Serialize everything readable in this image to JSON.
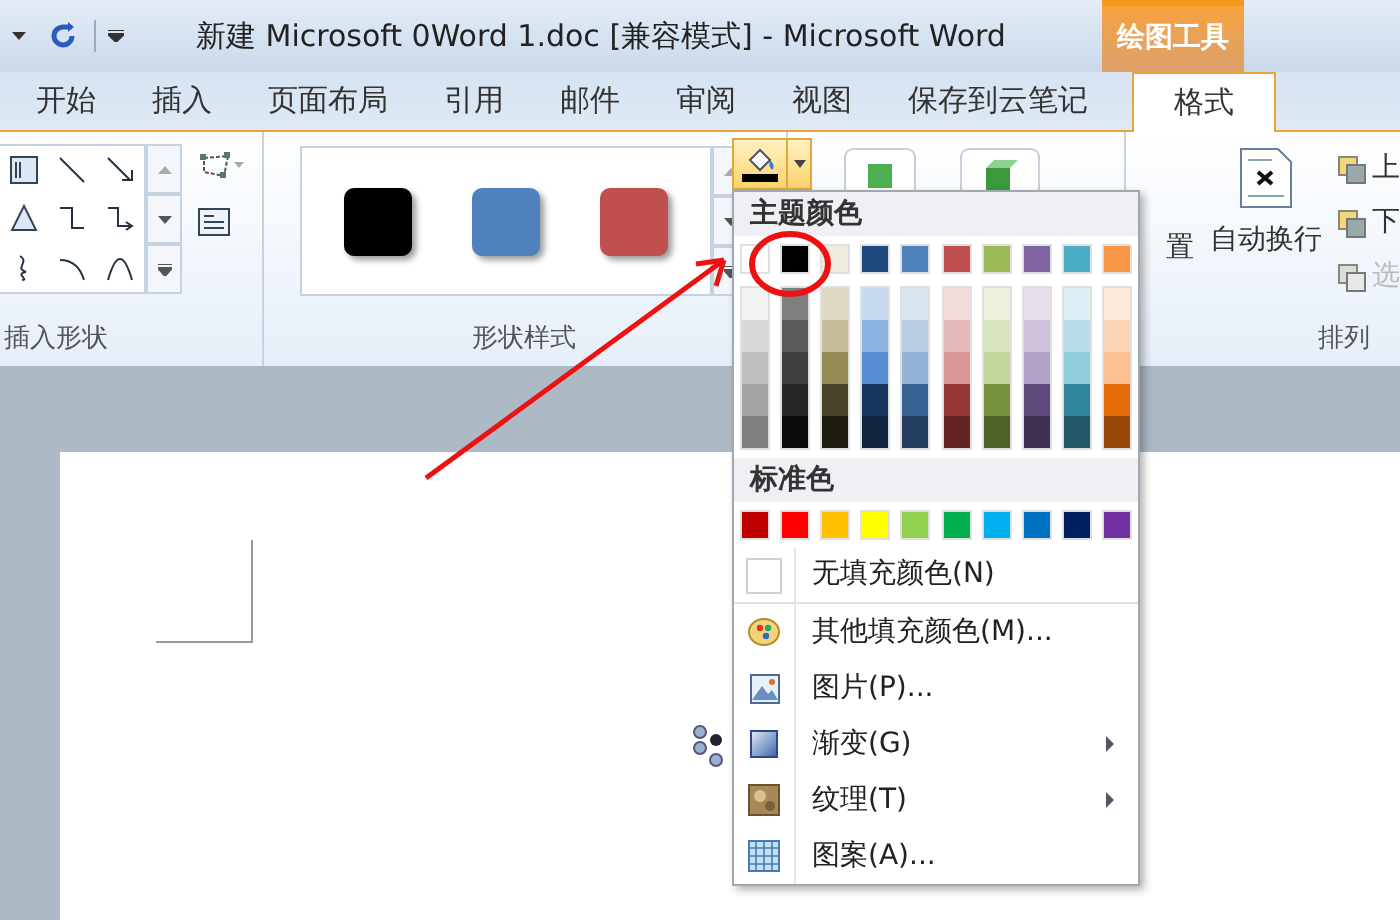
{
  "window": {
    "title": "新建 Microsoft 0Word 1.doc [兼容模式]  -  Microsoft Word",
    "context_tab_group": "绘图工具"
  },
  "tabs": [
    {
      "label": "开始",
      "selected": false
    },
    {
      "label": "插入",
      "selected": false
    },
    {
      "label": "页面布局",
      "selected": false
    },
    {
      "label": "引用",
      "selected": false
    },
    {
      "label": "邮件",
      "selected": false
    },
    {
      "label": "审阅",
      "selected": false
    },
    {
      "label": "视图",
      "selected": false
    },
    {
      "label": "保存到云笔记",
      "selected": false
    },
    {
      "label": "格式",
      "selected": true
    }
  ],
  "ribbon": {
    "groups": [
      {
        "label": "插入形状"
      },
      {
        "label": "形状样式"
      },
      {
        "label": "排列"
      }
    ],
    "style_swatches": [
      {
        "color": "#000000"
      },
      {
        "color": "#4f81bd"
      },
      {
        "color": "#c0504d"
      }
    ],
    "buttons": [
      {
        "label": "置"
      },
      {
        "label": "自动换行"
      }
    ],
    "arrange_items": [
      {
        "label": "上",
        "disabled": false
      },
      {
        "label": "下",
        "disabled": false
      },
      {
        "label": "选",
        "disabled": true
      }
    ]
  },
  "fill_menu": {
    "theme_heading": "主题颜色",
    "theme_colors": [
      {
        "color": "#ffffff",
        "shades": [
          {
            "color": "#f2f2f2"
          },
          {
            "color": "#d8d8d8"
          },
          {
            "color": "#bfbfbf"
          },
          {
            "color": "#a5a5a5"
          },
          {
            "color": "#7f7f7f"
          }
        ]
      },
      {
        "color": "#000000",
        "shades": [
          {
            "color": "#7f7f7f"
          },
          {
            "color": "#595959"
          },
          {
            "color": "#3f3f3f"
          },
          {
            "color": "#262626"
          },
          {
            "color": "#0c0c0c"
          }
        ]
      },
      {
        "color": "#eeece1",
        "shades": [
          {
            "color": "#ddd9c3"
          },
          {
            "color": "#c4bd97"
          },
          {
            "color": "#938953"
          },
          {
            "color": "#494429"
          },
          {
            "color": "#1d1b10"
          }
        ]
      },
      {
        "color": "#1f497d",
        "shades": [
          {
            "color": "#c6d9f0"
          },
          {
            "color": "#8db3e2"
          },
          {
            "color": "#548dd4"
          },
          {
            "color": "#17365d"
          },
          {
            "color": "#0f243e"
          }
        ]
      },
      {
        "color": "#4f81bd",
        "shades": [
          {
            "color": "#dbe5f1"
          },
          {
            "color": "#b8cce4"
          },
          {
            "color": "#95b3d7"
          },
          {
            "color": "#366092"
          },
          {
            "color": "#244061"
          }
        ]
      },
      {
        "color": "#c0504d",
        "shades": [
          {
            "color": "#f2dcdb"
          },
          {
            "color": "#e5b9b7"
          },
          {
            "color": "#d99694"
          },
          {
            "color": "#953734"
          },
          {
            "color": "#632423"
          }
        ]
      },
      {
        "color": "#9bbb59",
        "shades": [
          {
            "color": "#ebf1dd"
          },
          {
            "color": "#d7e3bc"
          },
          {
            "color": "#c3d69b"
          },
          {
            "color": "#76923c"
          },
          {
            "color": "#4f6128"
          }
        ]
      },
      {
        "color": "#8064a2",
        "shades": [
          {
            "color": "#e5e0ec"
          },
          {
            "color": "#ccc1d9"
          },
          {
            "color": "#b2a2c7"
          },
          {
            "color": "#5f497a"
          },
          {
            "color": "#3f3151"
          }
        ]
      },
      {
        "color": "#4bacc6",
        "shades": [
          {
            "color": "#dbeef3"
          },
          {
            "color": "#b7dde8"
          },
          {
            "color": "#92cddc"
          },
          {
            "color": "#31859b"
          },
          {
            "color": "#205867"
          }
        ]
      },
      {
        "color": "#f79646",
        "shades": [
          {
            "color": "#fdeada"
          },
          {
            "color": "#fbd5b5"
          },
          {
            "color": "#fac08f"
          },
          {
            "color": "#e36c09"
          },
          {
            "color": "#974806"
          }
        ]
      }
    ],
    "standard_heading": "标准色",
    "standard_colors": [
      {
        "color": "#c00000"
      },
      {
        "color": "#ff0000"
      },
      {
        "color": "#ffc000"
      },
      {
        "color": "#ffff00"
      },
      {
        "color": "#92d050"
      },
      {
        "color": "#00b050"
      },
      {
        "color": "#00b0f0"
      },
      {
        "color": "#0070c0"
      },
      {
        "color": "#002060"
      },
      {
        "color": "#7030a0"
      }
    ],
    "items": [
      {
        "kind": "none",
        "label": "无填充颜色(N)",
        "submenu": false
      },
      {
        "kind": "palette",
        "label": "其他填充颜色(M)...",
        "submenu": false
      },
      {
        "kind": "picture",
        "label": "图片(P)...",
        "submenu": false
      },
      {
        "kind": "gradient",
        "label": "渐变(G)",
        "submenu": true
      },
      {
        "kind": "texture",
        "label": "纹理(T)",
        "submenu": true
      },
      {
        "kind": "pattern",
        "label": "图案(A)...",
        "submenu": false
      }
    ]
  }
}
